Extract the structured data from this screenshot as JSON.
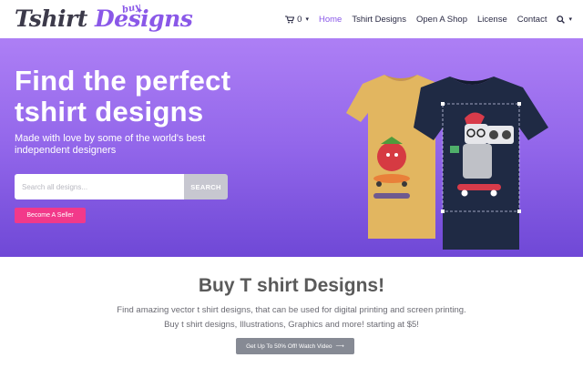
{
  "brand": {
    "logo_main": "Tshirt ",
    "logo_accent": "Designs",
    "logo_badge": "buy",
    "accent_color": "#8a58e8"
  },
  "nav": {
    "cart_count": "0",
    "items": [
      {
        "label": "Home",
        "active": true
      },
      {
        "label": "Tshirt Designs",
        "active": false
      },
      {
        "label": "Open A Shop",
        "active": false
      },
      {
        "label": "License",
        "active": false
      },
      {
        "label": "Contact",
        "active": false
      }
    ],
    "icons": [
      "cart-icon",
      "chevron-down-icon",
      "search-icon"
    ]
  },
  "hero": {
    "title": "Find the perfect tshirt designs",
    "subtitle": "Made with love by some of the world's best independent designers",
    "search_placeholder": "Search all designs...",
    "search_button": "SEARCH",
    "seller_button": "Become A Seller",
    "gradient_top": "#ad7ff5",
    "gradient_bottom": "#6f48d6",
    "seller_color": "#f2398a"
  },
  "section": {
    "title": "Buy T shirt Designs!",
    "line1": "Find amazing vector t shirt designs, that can be used for digital printing and screen printing.",
    "line2": "Buy t shirt designs, Illustrations, Graphics and more! starting at $5!",
    "video_button": "Get Up To 50% Off! Watch Video",
    "video_arrow": "⟶"
  }
}
